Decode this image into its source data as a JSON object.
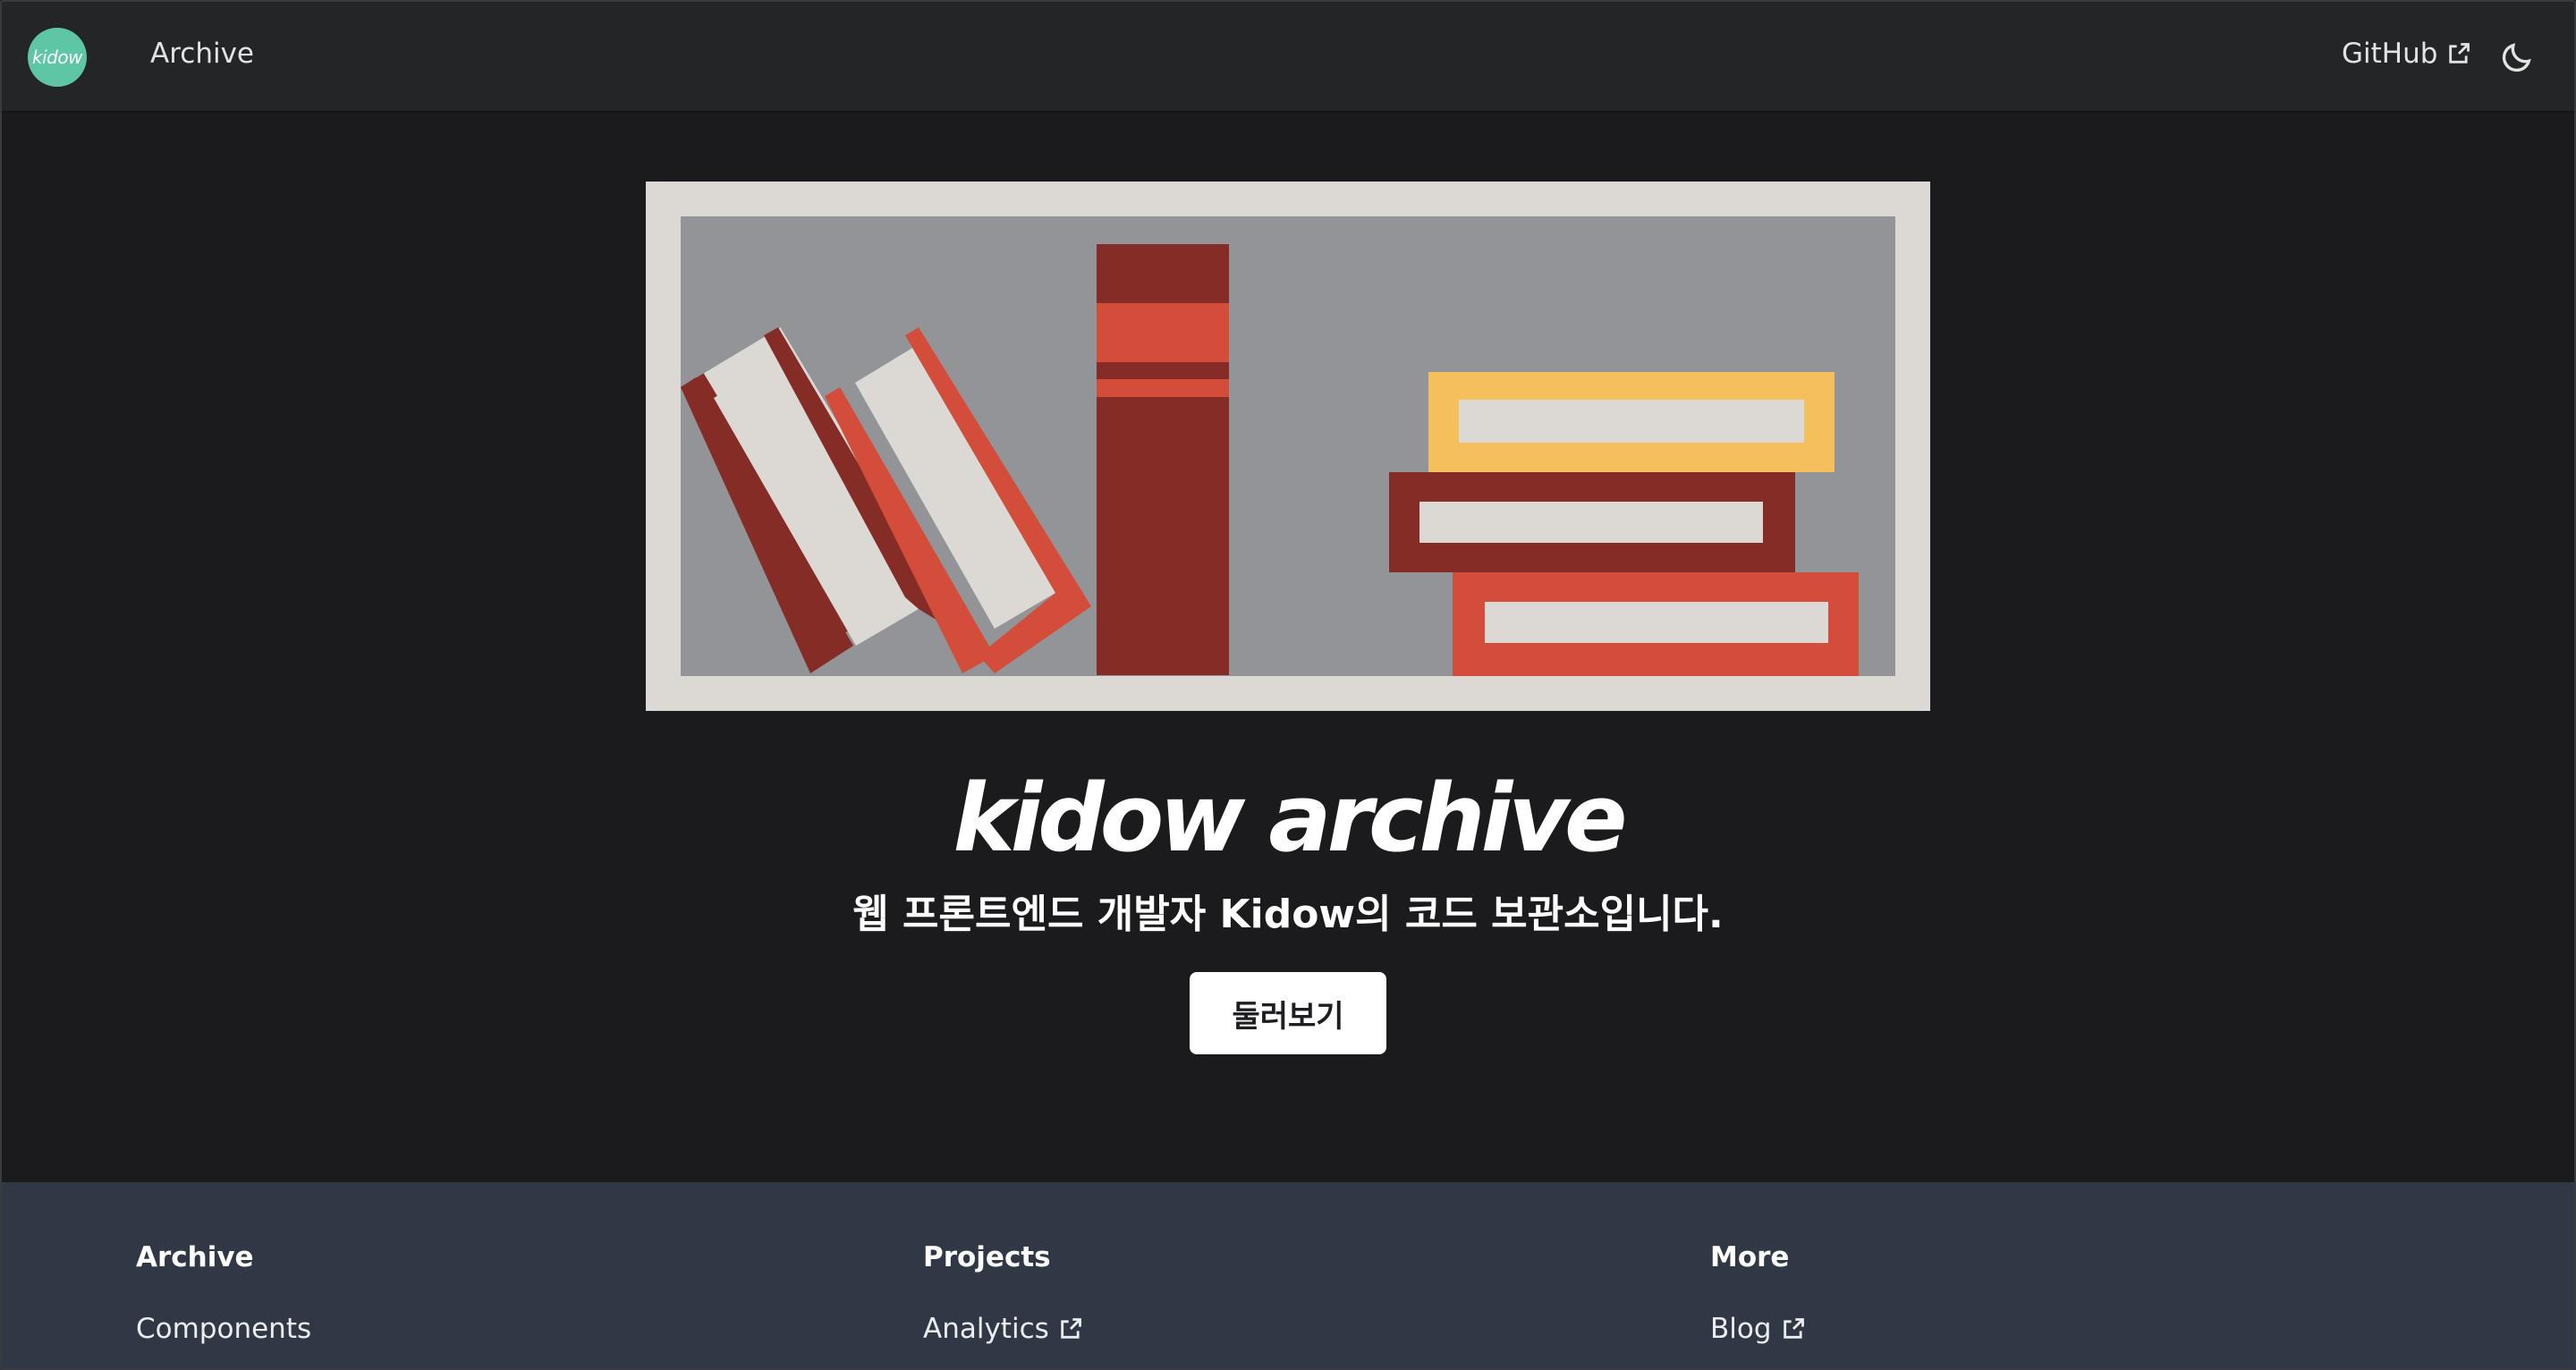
{
  "navbar": {
    "logo_text": "kidow",
    "archive_link": "Archive",
    "github_link": "GitHub",
    "external_icon": "external-link-icon",
    "theme_icon": "moon-icon"
  },
  "hero": {
    "title": "kidow archive",
    "subtitle": "웹 프론트엔드 개발자 Kidow의 코드 보관소입니다.",
    "cta_label": "둘러보기",
    "illustration": "bookshelf-illustration",
    "colors": {
      "frame": "#dcd9d5",
      "shelf_bg": "#939498",
      "dark_red": "#852c27",
      "red": "#d44d3b",
      "yellow": "#f5c05b",
      "page": "#dcd9d5"
    }
  },
  "footer": {
    "columns": [
      {
        "heading": "Archive",
        "links": [
          "Components"
        ]
      },
      {
        "heading": "Projects",
        "links": [
          "Analytics"
        ]
      },
      {
        "heading": "More",
        "links": [
          "Blog"
        ]
      }
    ]
  },
  "colors": {
    "background": "#1b1b1d",
    "navbar": "#242526",
    "footer": "#303846",
    "logo": "#5ec6a4"
  }
}
